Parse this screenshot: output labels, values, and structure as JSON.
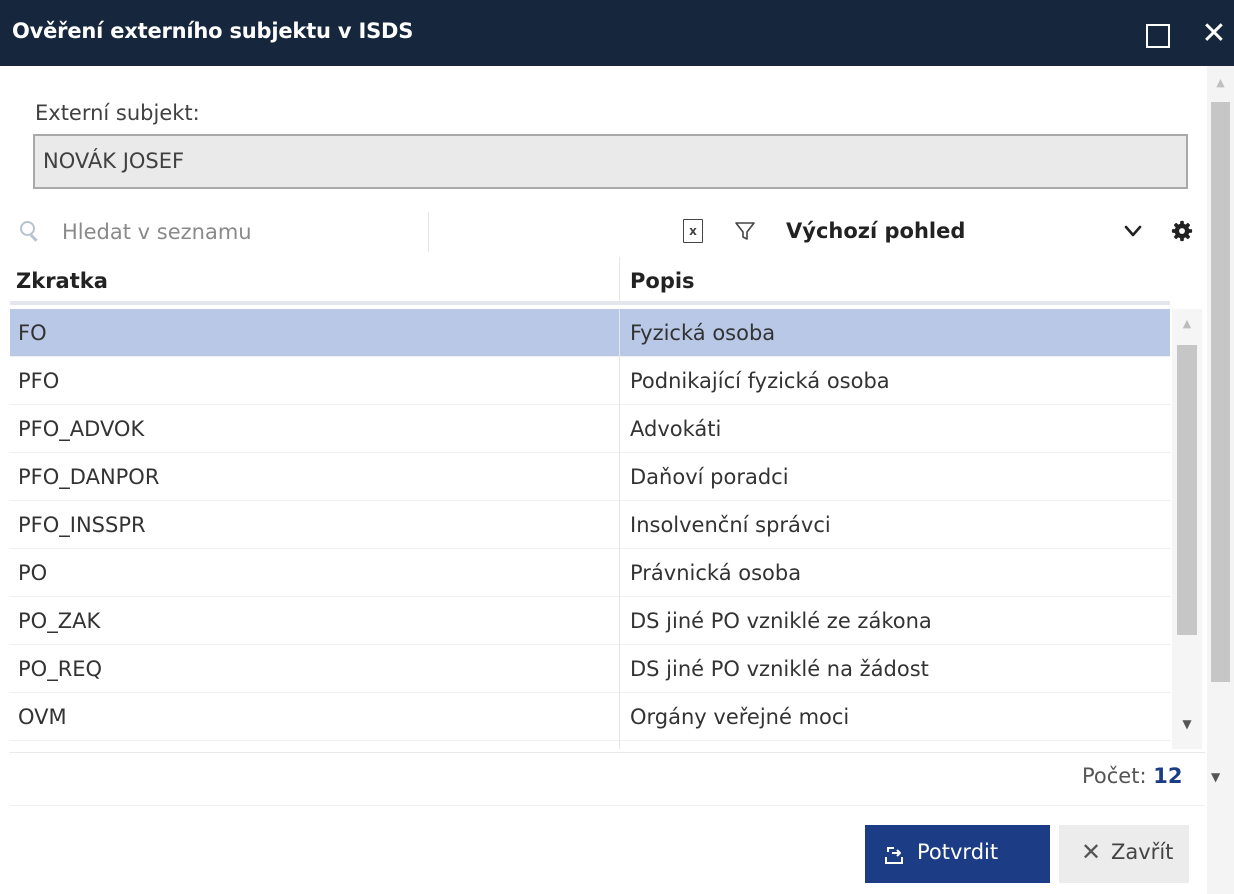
{
  "window": {
    "title": "Ověření externího subjektu v ISDS",
    "close_glyph": "✕"
  },
  "form": {
    "external_label": "Externí subjekt:",
    "external_value": "NOVÁK JOSEF"
  },
  "toolbar": {
    "search_placeholder": "Hledat v seznamu",
    "excel_glyph": "x",
    "view_label": "Výchozí pohled"
  },
  "grid": {
    "columns": [
      "Zkratka",
      "Popis"
    ],
    "rows": [
      {
        "code": "FO",
        "desc": "Fyzická osoba",
        "selected": true
      },
      {
        "code": "PFO",
        "desc": "Podnikající fyzická osoba"
      },
      {
        "code": "PFO_ADVOK",
        "desc": "Advokáti"
      },
      {
        "code": "PFO_DANPOR",
        "desc": "Daňoví poradci"
      },
      {
        "code": "PFO_INSSPR",
        "desc": "Insolvenční správci"
      },
      {
        "code": "PO",
        "desc": "Právnická osoba"
      },
      {
        "code": "PO_ZAK",
        "desc": "DS jiné PO vzniklé ze zákona"
      },
      {
        "code": "PO_REQ",
        "desc": "DS jiné PO vzniklé na žádost"
      },
      {
        "code": "OVM",
        "desc": "Orgány veřejné moci"
      }
    ],
    "count_label": "Počet:",
    "count_value": "12"
  },
  "buttons": {
    "confirm": "Potvrdit",
    "close": "Zavřít",
    "close_glyph": "✕"
  },
  "colors": {
    "titlebar": "#16263c",
    "accent": "#1c3c85",
    "selected_row": "#b8c8e6"
  }
}
